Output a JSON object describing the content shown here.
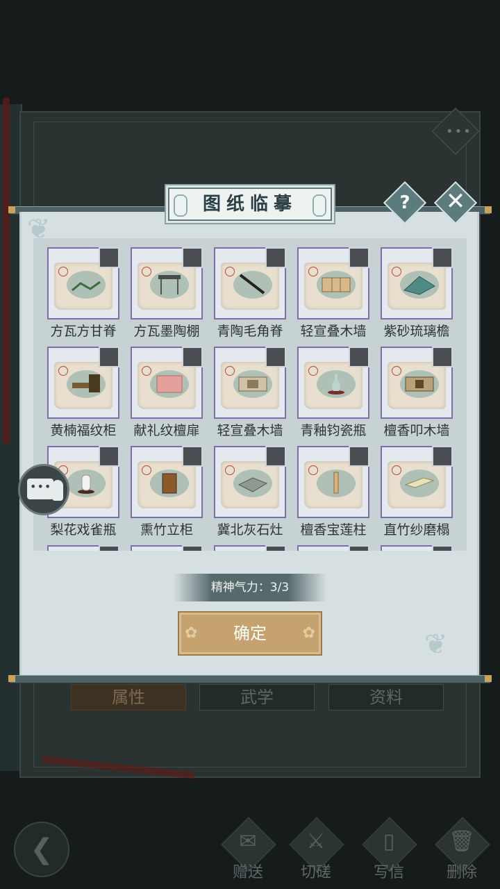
{
  "background": {
    "tabs": [
      "属性",
      "武学",
      "资料"
    ],
    "actions": [
      {
        "label": "赠送",
        "icon": "scroll-icon"
      },
      {
        "label": "切磋",
        "icon": "sword-icon"
      },
      {
        "label": "写信",
        "icon": "letter-icon"
      },
      {
        "label": "删除",
        "icon": "trash-icon"
      }
    ]
  },
  "dialog": {
    "title": "图纸临摹",
    "help": "?",
    "items": [
      {
        "name": "方瓦方甘脊"
      },
      {
        "name": "方瓦墨陶棚"
      },
      {
        "name": "青陶毛角脊"
      },
      {
        "name": "轻宣叠木墙"
      },
      {
        "name": "紫砂琉璃檐"
      },
      {
        "name": "黄楠福纹柜"
      },
      {
        "name": "献礼纹檀扉"
      },
      {
        "name": "轻宣叠木墙"
      },
      {
        "name": "青釉钧瓷瓶"
      },
      {
        "name": "檀香叩木墙"
      },
      {
        "name": "梨花戏雀瓶"
      },
      {
        "name": "熏竹立柜"
      },
      {
        "name": "冀北灰石灶"
      },
      {
        "name": "檀香宝莲柱"
      },
      {
        "name": "直竹纱磨榻"
      }
    ],
    "energy_text": "精神气力：3/3",
    "confirm_label": "确定"
  },
  "colors": {
    "accent_gold": "#c6a26e",
    "dialog_bg": "#d6e0e2",
    "card_border": "#7d6da8"
  }
}
